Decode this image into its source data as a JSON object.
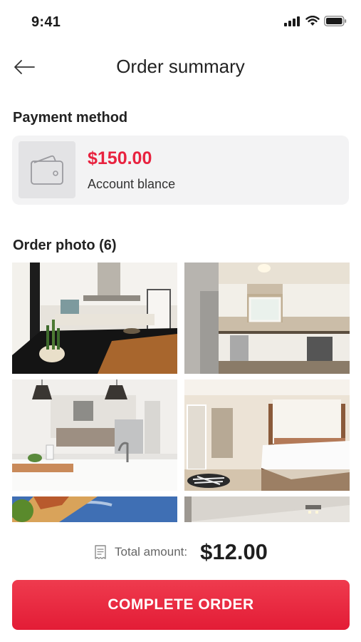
{
  "status_bar": {
    "time": "9:41"
  },
  "header": {
    "title": "Order summary"
  },
  "payment": {
    "section_title": "Payment method",
    "amount": "$150.00",
    "label": "Account blance"
  },
  "photos": {
    "section_title": "Order photo (6)",
    "items": [
      {
        "icon": "kitchen-photo-1"
      },
      {
        "icon": "kitchen-photo-2"
      },
      {
        "icon": "kitchen-photo-3"
      },
      {
        "icon": "bedroom-photo-4"
      },
      {
        "icon": "house-exterior-photo-5"
      },
      {
        "icon": "interior-photo-6"
      }
    ]
  },
  "total": {
    "label": "Total amount:",
    "value": "$12.00"
  },
  "actions": {
    "complete_label": "COMPLETE ORDER"
  },
  "colors": {
    "accent": "#e8223f",
    "button": "#e31c36",
    "card_bg": "#f3f3f4"
  }
}
